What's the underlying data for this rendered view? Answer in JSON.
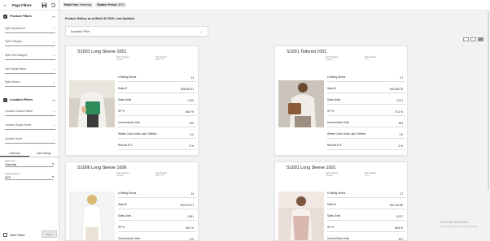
{
  "panel": {
    "title": "Page Filters",
    "product_filters": "Product Filters",
    "product_fields": [
      "Style Department",
      "Style Category",
      "Style Sub Category",
      "Size Range Name",
      "Style Season"
    ],
    "location_filters": "Location Filters",
    "location_fields": [
      "Location Channel Name",
      "Location Region Name",
      "Location Name"
    ],
    "tabs": [
      "Calendar",
      "Date Range"
    ],
    "date_fields": [
      {
        "label": "Retail Year",
        "value": "Yesterday"
      },
      {
        "label": "Relative Period",
        "value": "WTD"
      }
    ],
    "defer_label": "Defer Filters",
    "apply_label": "Apply"
  },
  "topbar": {
    "chips": [
      {
        "key": "Retail Year:",
        "value": "Yesterday"
      },
      {
        "key": "Relative Period:",
        "value": "WTD"
      }
    ]
  },
  "content": {
    "gallery_title": "Product Gallery as at Week 50 2020, Last Updated",
    "analysis_label": "Analysis Filter"
  },
  "cards": [
    {
      "title": "S1001 Long Sleeve 1001",
      "meta": [
        {
          "label": "Style Category",
          "value": "Updates"
        },
        {
          "label": "Style Season",
          "value": "Winter 20"
        }
      ],
      "rows": [
        {
          "k": "# Selling Stores",
          "v": "24"
        },
        {
          "k": "Sales $",
          "v": "$26,965.21"
        },
        {
          "k": "Sales Units",
          "v": "1,220"
        },
        {
          "k": "GP %",
          "v": "68.8 %"
        },
        {
          "k": "Current Book Units",
          "v": "240"
        },
        {
          "k": "Weeks Cover Units Last 4 Weeks",
          "v": "0.0"
        },
        {
          "k": "Returns $ %",
          "v": "0 %"
        }
      ]
    },
    {
      "title": "S1001 Tailored 1001",
      "meta": [
        {
          "label": "Style Category",
          "value": "Updates"
        },
        {
          "label": "Style Season",
          "value": "Core"
        }
      ],
      "rows": [
        {
          "k": "# Selling Stores",
          "v": "27"
        },
        {
          "k": "Sales $",
          "v": "$47,845.79"
        },
        {
          "k": "Sales Units",
          "v": "2,271"
        },
        {
          "k": "GP %",
          "v": "70.2 %"
        },
        {
          "k": "Current Book Units",
          "v": "493"
        },
        {
          "k": "Weeks Cover Units Last 4 Weeks",
          "v": "0.0"
        },
        {
          "k": "Returns $ %",
          "v": "0 %"
        }
      ]
    },
    {
      "title": "S1006 Long Sleeve 1006",
      "meta": [
        {
          "label": "Style Category",
          "value": "Updates"
        },
        {
          "label": "Style Season",
          "value": "Winter 20"
        }
      ],
      "rows": [
        {
          "k": "# Selling Stores",
          "v": "24"
        },
        {
          "k": "Sales $",
          "v": "$47,472.27"
        },
        {
          "k": "Sales Units",
          "v": "1,551"
        },
        {
          "k": "GP %",
          "v": "66.2 %"
        },
        {
          "k": "Current Book Units",
          "v": "179"
        }
      ]
    },
    {
      "title": "S1001 Long Sleeve 1001",
      "meta": [
        {
          "label": "Style Category",
          "value": "Updates"
        },
        {
          "label": "Style Season",
          "value": "Core"
        }
      ],
      "rows": [
        {
          "k": "# Selling Stores",
          "v": "27"
        },
        {
          "k": "Sales $",
          "v": "$47,241.55"
        },
        {
          "k": "Sales Units",
          "v": "3,027"
        },
        {
          "k": "GP %",
          "v": "68.8 %"
        },
        {
          "k": "Current Book Units",
          "v": "527"
        }
      ]
    }
  ],
  "watermark": {
    "line1": "Activate Windows",
    "line2": "Go to Settings to activate Windows."
  }
}
